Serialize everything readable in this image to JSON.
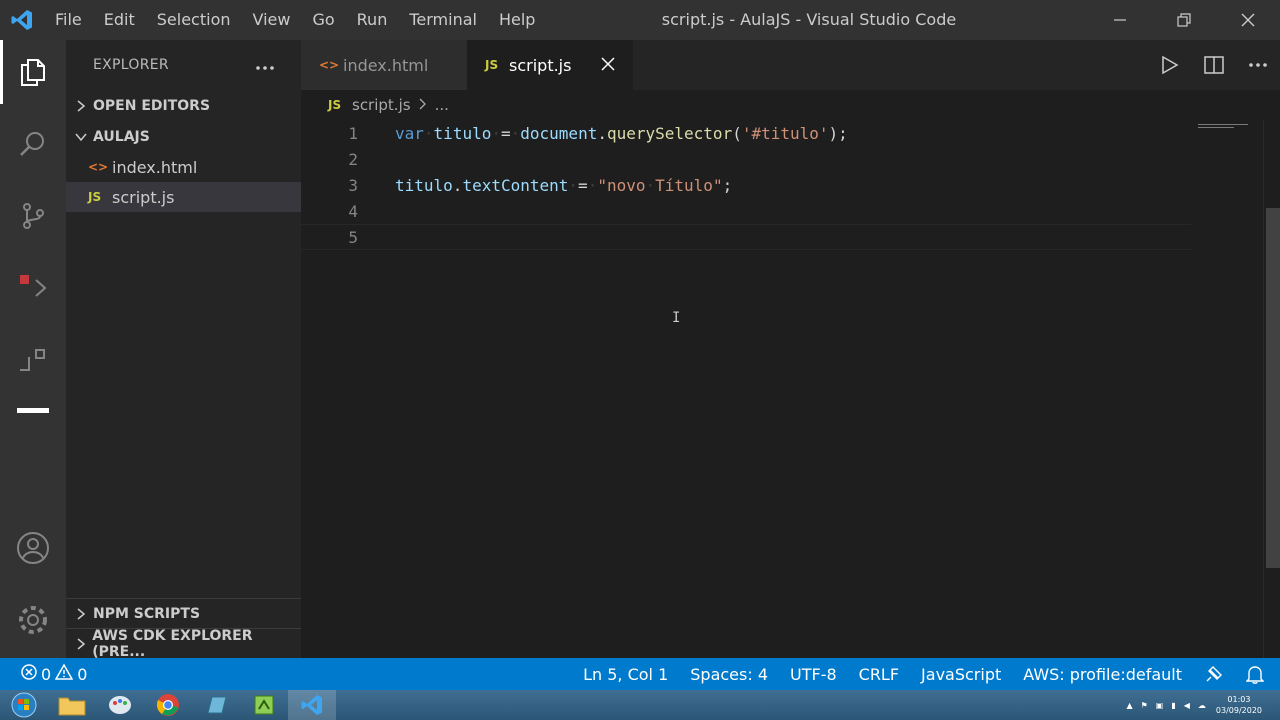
{
  "window": {
    "title": "script.js - AulaJS - Visual Studio Code",
    "menu": [
      "File",
      "Edit",
      "Selection",
      "View",
      "Go",
      "Run",
      "Terminal",
      "Help"
    ]
  },
  "sidebar": {
    "title": "EXPLORER",
    "sections": {
      "open_editors": "OPEN EDITORS",
      "folder": "AULAJS",
      "npm": "NPM SCRIPTS",
      "aws": "AWS CDK EXPLORER (PRE..."
    },
    "files": [
      {
        "name": "index.html",
        "type": "html"
      },
      {
        "name": "script.js",
        "type": "js",
        "selected": true
      }
    ]
  },
  "tabs": [
    {
      "label": "index.html",
      "active": false
    },
    {
      "label": "script.js",
      "active": true
    }
  ],
  "breadcrumb": {
    "file": "script.js",
    "rest": "..."
  },
  "editor": {
    "lines": [
      {
        "number": "1"
      },
      {
        "number": "2"
      },
      {
        "number": "3"
      },
      {
        "number": "4"
      },
      {
        "number": "5"
      }
    ],
    "code": {
      "line1": {
        "kw": "var",
        "var": "titulo",
        "op": "=",
        "obj": "document",
        "fn": "querySelector",
        "str": "'#titulo'",
        "end": ");"
      },
      "line3": {
        "obj": "titulo",
        "prop": "textContent",
        "op": "=",
        "str_open": "\"novo",
        "str_close": "Título\"",
        "end": ";"
      }
    }
  },
  "statusbar": {
    "errors": "0",
    "warnings": "0",
    "position": "Ln 5, Col 1",
    "spaces": "Spaces: 4",
    "encoding": "UTF-8",
    "eol": "CRLF",
    "language": "JavaScript",
    "aws": "AWS: profile:default"
  },
  "taskbar": {
    "time": "01:03",
    "date": "03/09/2020"
  },
  "colors": {
    "accent": "#007acc",
    "js_icon": "#cbcb41",
    "html_icon": "#e37933"
  }
}
